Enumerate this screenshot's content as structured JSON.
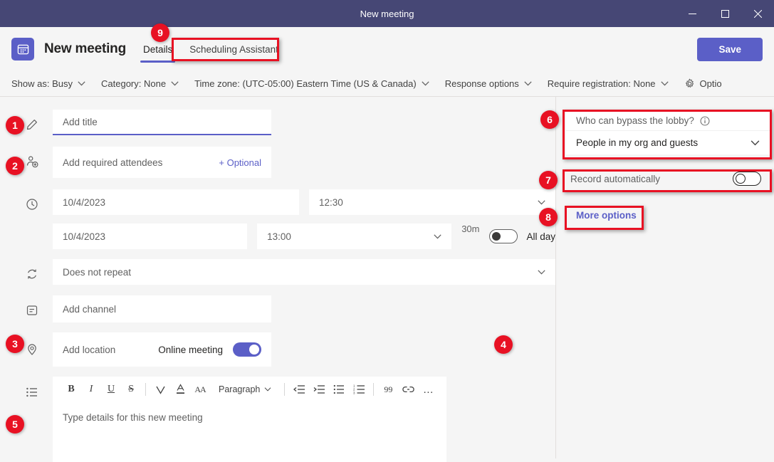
{
  "window": {
    "title": "New meeting",
    "minimize_icon": "minimize-icon",
    "maximize_icon": "maximize-icon",
    "close_icon": "close-icon"
  },
  "header": {
    "app_icon": "calendar-icon",
    "title": "New meeting",
    "tabs": [
      {
        "label": "Details",
        "active": true
      },
      {
        "label": "Scheduling Assistant",
        "active": false
      }
    ],
    "save_label": "Save"
  },
  "optionbar": {
    "items": [
      {
        "label": "Show as: Busy",
        "icon": "chevron-down-icon"
      },
      {
        "label": "Category: None",
        "icon": "chevron-down-icon"
      },
      {
        "label": "Time zone: (UTC-05:00) Eastern Time (US & Canada)",
        "icon": "chevron-down-icon"
      },
      {
        "label": "Response options",
        "icon": "chevron-down-icon"
      },
      {
        "label": "Require registration: None",
        "icon": "chevron-down-icon"
      },
      {
        "label": "Optio",
        "icon": "gear-icon"
      }
    ]
  },
  "form": {
    "title_placeholder": "Add title",
    "title_value": "",
    "attendees_placeholder": "Add required attendees",
    "attendees_value": "",
    "optional_label": "+ Optional",
    "start_date": "10/4/2023",
    "start_time": "12:30",
    "end_date": "10/4/2023",
    "end_time": "13:00",
    "duration": "30m",
    "all_day_label": "All day",
    "all_day_on": false,
    "repeat_value": "Does not repeat",
    "channel_placeholder": "Add channel",
    "location_placeholder": "Add location",
    "online_meeting_label": "Online meeting",
    "online_meeting_on": true,
    "details_placeholder": "Type details for this new meeting",
    "icons": {
      "title": "pencil-icon",
      "attendees": "add-person-icon",
      "time": "clock-icon",
      "repeat": "repeat-icon",
      "channel": "channel-icon",
      "location": "location-pin-icon",
      "details": "bullet-list-icon"
    }
  },
  "editor_toolbar": {
    "buttons": [
      {
        "name": "bold-icon",
        "glyph": "B"
      },
      {
        "name": "italic-icon",
        "glyph": "I"
      },
      {
        "name": "underline-icon",
        "glyph": "U"
      },
      {
        "name": "strikethrough-icon",
        "glyph": "S"
      },
      {
        "name": "highlight-icon",
        "glyph": "∇"
      },
      {
        "name": "font-color-icon",
        "glyph": "A"
      },
      {
        "name": "font-size-icon",
        "glyph": "AA"
      },
      {
        "name": "decrease-indent-icon",
        "glyph": ""
      },
      {
        "name": "increase-indent-icon",
        "glyph": ""
      },
      {
        "name": "bullet-list-icon",
        "glyph": ""
      },
      {
        "name": "numbered-list-icon",
        "glyph": ""
      },
      {
        "name": "quote-icon",
        "glyph": "99"
      },
      {
        "name": "link-icon",
        "glyph": ""
      },
      {
        "name": "more-icon",
        "glyph": "…"
      }
    ],
    "paragraph_label": "Paragraph"
  },
  "right_panel": {
    "lobby_label": "Who can bypass the lobby?",
    "lobby_info_icon": "info-icon",
    "lobby_value": "People in my org and guests",
    "record_label": "Record automatically",
    "record_on": false,
    "more_options_label": "More options"
  },
  "annotations": {
    "badges": [
      {
        "number": "1"
      },
      {
        "number": "2"
      },
      {
        "number": "3"
      },
      {
        "number": "4"
      },
      {
        "number": "5"
      },
      {
        "number": "6"
      },
      {
        "number": "7"
      },
      {
        "number": "8"
      },
      {
        "number": "9"
      }
    ]
  },
  "colors": {
    "brand_purple": "#5B5FC7",
    "titlebar": "#464775",
    "annotation_red": "#E81123",
    "page_bg": "#F5F5F5"
  }
}
